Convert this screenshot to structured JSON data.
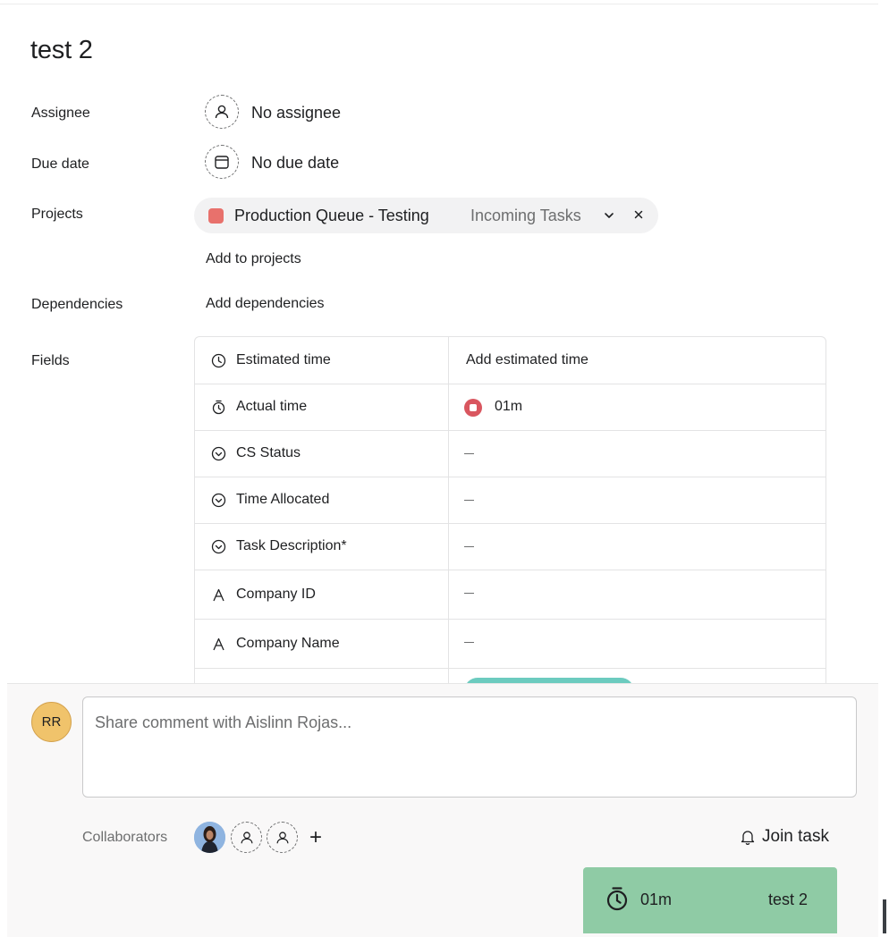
{
  "task": {
    "title": "test 2"
  },
  "labels": {
    "assignee": "Assignee",
    "due_date": "Due date",
    "projects": "Projects",
    "dependencies": "Dependencies",
    "fields": "Fields"
  },
  "assignee": {
    "value": "No assignee",
    "icon": "user-icon"
  },
  "due_date": {
    "value": "No due date",
    "icon": "calendar-icon"
  },
  "project": {
    "name": "Production Queue - Testing",
    "section": "Incoming Tasks",
    "color": "#e8716c"
  },
  "actions": {
    "add_to_projects": "Add to projects",
    "add_dependencies": "Add dependencies"
  },
  "fields": [
    {
      "name": "Estimated time",
      "icon": "clock-icon",
      "value": "Add estimated time"
    },
    {
      "name": "Actual time",
      "icon": "stopwatch-icon",
      "value": "01m"
    },
    {
      "name": "CS Status",
      "icon": "dropdown-circle-icon",
      "value": ""
    },
    {
      "name": "Time Allocated",
      "icon": "dropdown-circle-icon",
      "value": ""
    },
    {
      "name": "Task Description*",
      "icon": "dropdown-circle-icon",
      "value": ""
    },
    {
      "name": "Company ID",
      "icon": "text-field-icon",
      "value": ""
    },
    {
      "name": "Company Name",
      "icon": "text-field-icon",
      "value": ""
    }
  ],
  "comment": {
    "avatar_initials": "RR",
    "placeholder": "Share comment with Aislinn Rojas..."
  },
  "collaborators": {
    "label": "Collaborators"
  },
  "join_task": {
    "label": "Join task"
  },
  "timer": {
    "time": "01m",
    "task_name": "test 2"
  },
  "colors": {
    "stop_button": "#d9565f",
    "timer_card": "#8fcba5",
    "avatar_bg": "#f0c36b",
    "teal_pill": "#6ccbbf"
  }
}
